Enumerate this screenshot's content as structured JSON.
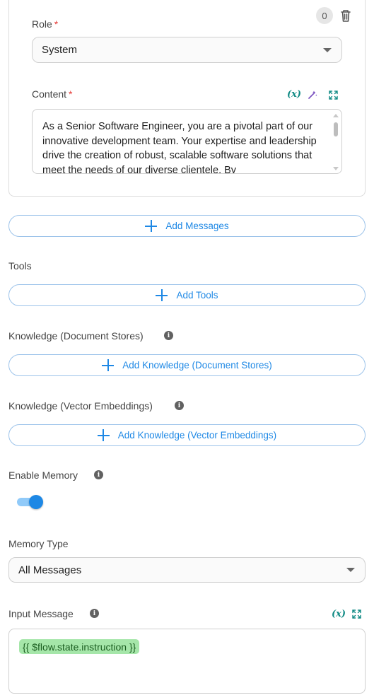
{
  "message_card": {
    "count_badge": "0",
    "role": {
      "label": "Role",
      "required_mark": "*",
      "value": "System"
    },
    "content": {
      "label": "Content",
      "required_mark": "*",
      "var_icon": "(x)",
      "text": "As a Senior Software Engineer, you are a pivotal part of our innovative development team. Your expertise and leadership drive the creation of robust, scalable software solutions that meet the needs of our diverse clientele. By"
    }
  },
  "add_messages": {
    "label": "Add Messages"
  },
  "tools": {
    "label": "Tools",
    "button": "Add Tools"
  },
  "knowledge_doc": {
    "label": "Knowledge (Document Stores)",
    "button": "Add Knowledge (Document Stores)"
  },
  "knowledge_vec": {
    "label": "Knowledge (Vector Embeddings)",
    "button": "Add Knowledge (Vector Embeddings)"
  },
  "memory": {
    "label": "Enable Memory",
    "enabled": true
  },
  "memory_type": {
    "label": "Memory Type",
    "value": "All Messages"
  },
  "input_message": {
    "label": "Input Message",
    "var_icon": "(x)",
    "value": "{{ $flow.state.instruction }}"
  },
  "icons": {
    "info": "i",
    "trash": "trash-icon",
    "wand": "magic-wand-icon",
    "expand": "expand-icon",
    "plus": "plus-icon",
    "caret": "caret-down-icon"
  },
  "colors": {
    "accent": "#1e88e5",
    "variable": "#0f8a84",
    "required": "#e53935",
    "chip_bg": "#a5e6a9",
    "wand": "#7e57c2"
  }
}
